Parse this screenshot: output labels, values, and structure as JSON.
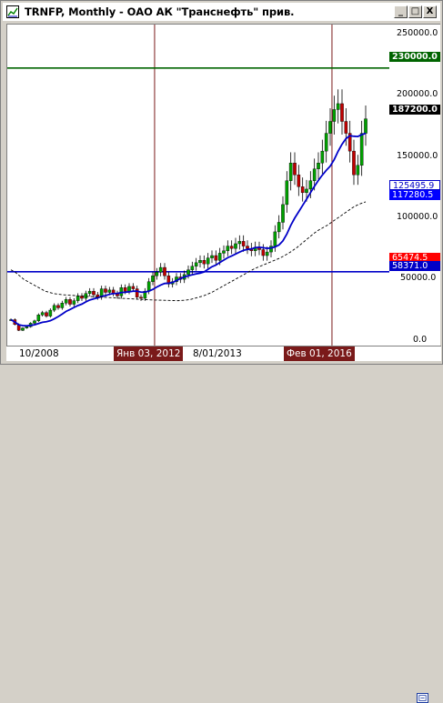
{
  "window": {
    "title": "TRNFP, Monthly - ОАО АК \"Транснефть\" прив.",
    "buttons": {
      "minimize": "_",
      "maximize": "□",
      "close": "X"
    }
  },
  "axis": {
    "ticks": [
      "250000.0",
      "200000.0",
      "150000.0",
      "100000.0",
      "50000.0",
      "0.0"
    ],
    "tags": {
      "level_high": "230000.0",
      "last_price": "187200.0",
      "ma_slow": "125495.9",
      "ma_fast": "117280.5",
      "red_level": "65474.5",
      "level_low": "58371.0"
    }
  },
  "xaxis": {
    "labels": [
      "10/2008",
      "Янв 03, 2012",
      "8/01/2013",
      "Фев 01, 2016"
    ]
  },
  "colors": {
    "hline": "#006400",
    "blue_line": "#0000c8",
    "vline": "#7a1a1a",
    "candle_up": "#00a000",
    "candle_down": "#c00000",
    "tag_red": "#ff0000",
    "tag_blue": "#0000ff"
  },
  "icons": {
    "app": "chart-window-icon",
    "scroll": "scroll-end-icon"
  },
  "chart_data": {
    "type": "candlestick",
    "symbol": "TRNFP",
    "period": "Monthly",
    "ylim": [
      0,
      262000
    ],
    "horizontal_levels": [
      230000,
      58371
    ],
    "markers": [
      "Янв 03, 2012",
      "Фев 01, 2016"
    ],
    "close": [
      18000,
      14000,
      9000,
      11000,
      12000,
      15000,
      17000,
      22000,
      24000,
      21000,
      26000,
      30000,
      28000,
      32000,
      35000,
      31000,
      34000,
      38000,
      36000,
      40000,
      42000,
      39000,
      37000,
      44000,
      41000,
      43000,
      40000,
      38000,
      45000,
      42000,
      46000,
      44000,
      37000,
      36000,
      42000,
      50000,
      55000,
      58000,
      62000,
      55000,
      48000,
      50000,
      54000,
      52000,
      56000,
      60000,
      63000,
      66000,
      68000,
      65000,
      70000,
      72000,
      68000,
      74000,
      76000,
      80000,
      78000,
      82000,
      84000,
      80000,
      78000,
      76000,
      79000,
      77000,
      72000,
      75000,
      80000,
      92000,
      100000,
      115000,
      135000,
      150000,
      140000,
      130000,
      125000,
      128000,
      135000,
      145000,
      150000,
      160000,
      175000,
      185000,
      195000,
      200000,
      185000,
      175000,
      160000,
      140000,
      148000,
      175000,
      187200
    ],
    "ma_fast": [
      60000,
      58000,
      55000,
      52000,
      50000,
      48000,
      46000,
      44000,
      42000,
      41000,
      40000,
      39500,
      39000,
      38800,
      38500,
      38300,
      38000,
      37800,
      37600,
      37400,
      37200,
      37000,
      36800,
      36600,
      36400,
      36200,
      36000,
      35800,
      35600,
      35400,
      35200,
      35000,
      34800,
      34600,
      34500,
      34400,
      34300,
      34200,
      34100,
      34000,
      34200,
      34500,
      35000,
      36000,
      37000,
      38000,
      39500,
      41000,
      43000,
      45000,
      47000,
      49000,
      51000,
      53000,
      55000,
      57000,
      59000,
      61000,
      62500,
      64000,
      65500,
      67000,
      68500,
      70000,
      72000,
      74000,
      76500,
      79000,
      82000,
      85000,
      88000,
      91000,
      93500,
      95500,
      97500,
      100000,
      102500,
      105000,
      107500,
      110000,
      112500,
      114500,
      116000,
      117280
    ]
  }
}
